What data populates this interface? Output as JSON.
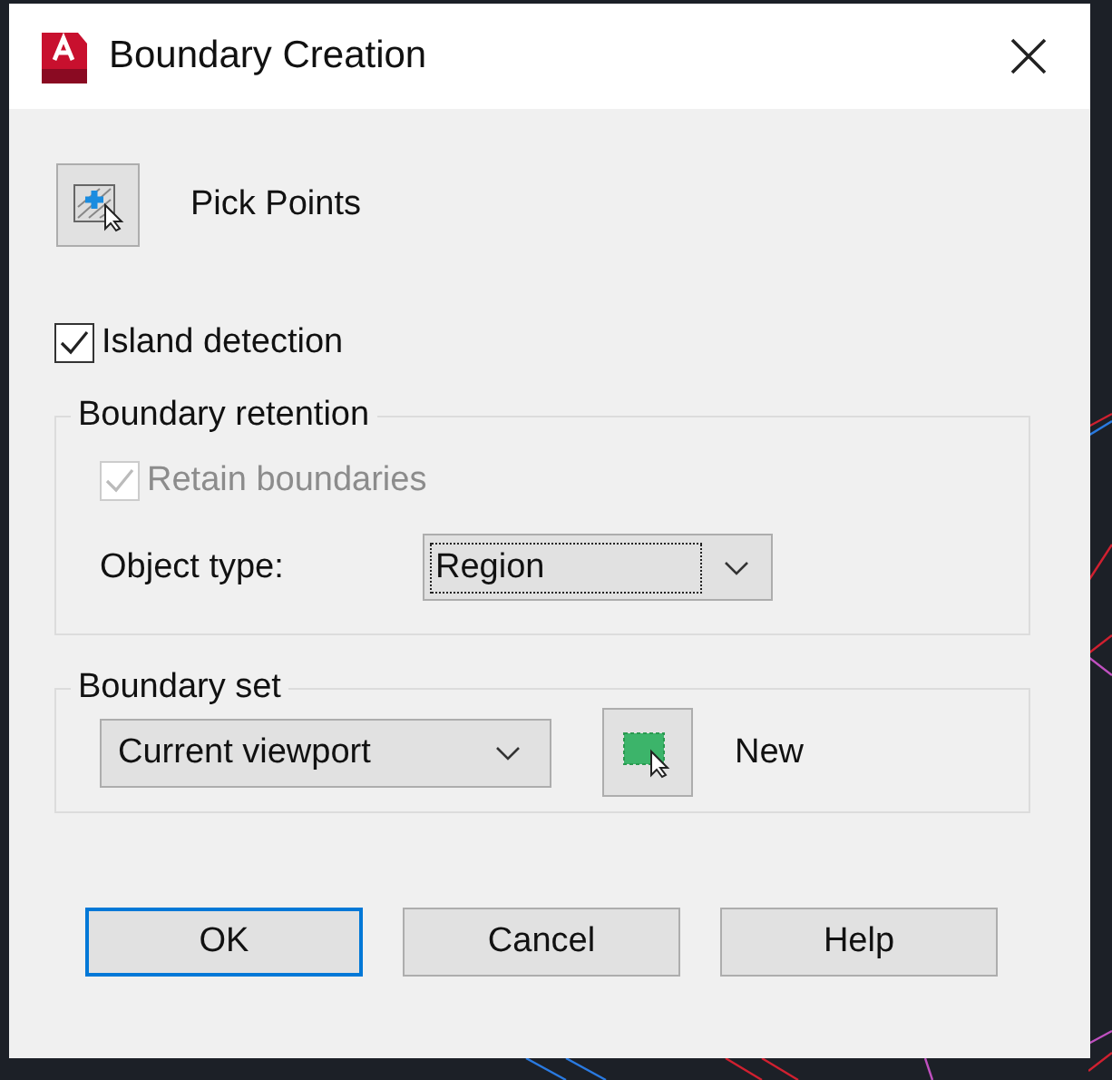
{
  "window": {
    "title": "Boundary Creation"
  },
  "pick_points": {
    "label": "Pick Points"
  },
  "island_detection": {
    "label": "Island detection",
    "checked": true
  },
  "boundary_retention": {
    "title": "Boundary retention",
    "retain_boundaries": {
      "label": "Retain boundaries",
      "checked": true,
      "disabled": true
    },
    "object_type": {
      "label": "Object type:",
      "value": "Region",
      "focused": true
    }
  },
  "boundary_set": {
    "title": "Boundary set",
    "value": "Current viewport",
    "new_label": "New"
  },
  "buttons": [
    {
      "label": "OK",
      "default": true
    },
    {
      "label": "Cancel",
      "default": false
    },
    {
      "label": "Help",
      "default": false
    }
  ]
}
